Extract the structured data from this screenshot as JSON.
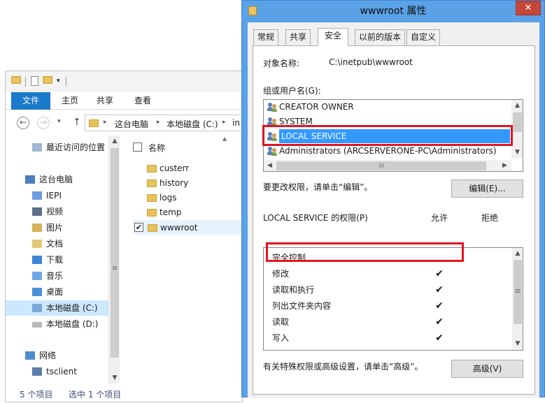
{
  "explorer": {
    "quick_access_arrow": "▾",
    "ribbon_tabs": [
      "文件",
      "主页",
      "共享",
      "查看"
    ],
    "nav": {
      "back_icon": "←",
      "forward_icon": "→",
      "dropdown_icon": "▾",
      "up_icon": "↑",
      "breadcrumb": [
        "这台电脑",
        "本地磁盘 (C:)",
        "in"
      ],
      "breadcrumb_sep": "▸"
    },
    "nav_pane": {
      "items": [
        {
          "label": "最近访问的位置",
          "icon": "recent-places-icon"
        },
        {
          "label": "这台电脑",
          "icon": "computer-icon"
        },
        {
          "label": "IEPI",
          "icon": "user-folder-icon"
        },
        {
          "label": "视频",
          "icon": "videos-icon"
        },
        {
          "label": "图片",
          "icon": "pictures-icon"
        },
        {
          "label": "文档",
          "icon": "documents-icon"
        },
        {
          "label": "下载",
          "icon": "downloads-icon"
        },
        {
          "label": "音乐",
          "icon": "music-icon"
        },
        {
          "label": "桌面",
          "icon": "desktop-icon"
        },
        {
          "label": "本地磁盘 (C:)",
          "icon": "drive-c-icon",
          "selected": true
        },
        {
          "label": "本地磁盘 (D:)",
          "icon": "drive-d-icon"
        },
        {
          "label": "网络",
          "icon": "network-icon"
        },
        {
          "label": "tsclient",
          "icon": "tsclient-icon"
        }
      ],
      "scroll_up": "▲",
      "scroll_down": "▼",
      "grip": "≡"
    },
    "file_pane": {
      "column_header": "名称",
      "sort_indicator": "▲",
      "files": [
        {
          "name": "custerr",
          "checked": false
        },
        {
          "name": "history",
          "checked": false
        },
        {
          "name": "logs",
          "checked": false
        },
        {
          "name": "temp",
          "checked": false
        },
        {
          "name": "wwwroot",
          "checked": true,
          "selected": true
        }
      ]
    },
    "status": {
      "item_count": "5 个项目",
      "selected": "选中 1 个项目"
    }
  },
  "dialog": {
    "title": "wwwroot 属性",
    "close_glyph": "✕",
    "tabs": [
      "常规",
      "共享",
      "安全",
      "以前的版本",
      "自定义"
    ],
    "active_tab": "安全",
    "object_name_label": "对象名称:",
    "object_name_value": "C:\\inetpub\\wwwroot",
    "groups_label": "组或用户名(G):",
    "groups": [
      {
        "name": "CREATOR OWNER"
      },
      {
        "name": "SYSTEM"
      },
      {
        "name": "LOCAL SERVICE",
        "selected": true
      },
      {
        "name": "Administrators (ARCSERVERONE-PC\\Administrators)"
      }
    ],
    "scroll_glyphs": {
      "up": "▲",
      "down": "▼",
      "left": "◀",
      "right": "▶",
      "grip_h": "III",
      "grip_v": "≡"
    },
    "edit_hint": "要更改权限，请单击“编辑”。",
    "edit_button": "编辑(E)...",
    "perms_label": "LOCAL SERVICE 的权限(P)",
    "allow_header": "允许",
    "deny_header": "拒绝",
    "permissions": [
      {
        "name": "完全控制",
        "allow": "",
        "deny": ""
      },
      {
        "name": "修改",
        "allow": "✔",
        "deny": ""
      },
      {
        "name": "读取和执行",
        "allow": "✔",
        "deny": ""
      },
      {
        "name": "列出文件夹内容",
        "allow": "✔",
        "deny": ""
      },
      {
        "name": "读取",
        "allow": "✔",
        "deny": ""
      },
      {
        "name": "写入",
        "allow": "✔",
        "deny": ""
      }
    ],
    "advanced_hint": "有关特殊权限或高级设置，请单击“高级”。",
    "advanced_button": "高级(V)"
  },
  "colors": {
    "accent_blue": "#1979ca",
    "selection_blue": "#3399ff",
    "highlight_red": "#e0151f",
    "title_blue": "#5aa1e5",
    "close_red": "#c7463a"
  }
}
